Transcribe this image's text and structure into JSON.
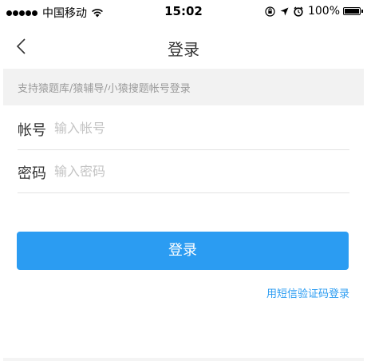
{
  "status_bar": {
    "carrier": "中国移动",
    "time": "15:02",
    "battery": "100%",
    "icons": [
      "signal-dots-icon",
      "wifi-icon",
      "orientation-lock-icon",
      "location-arrow-icon",
      "alarm-icon",
      "battery-icon"
    ]
  },
  "nav": {
    "back_icon": "chevron-left-icon",
    "title": "登录"
  },
  "hint": "支持猿题库/猿辅导/小猿搜题帐号登录",
  "form": {
    "account": {
      "label": "帐号",
      "placeholder": "输入帐号",
      "value": ""
    },
    "password": {
      "label": "密码",
      "placeholder": "输入密码",
      "value": ""
    }
  },
  "login_button": "登录",
  "sms_login_link": "用短信验证码登录",
  "colors": {
    "accent": "#2b9cf2",
    "hint_background": "#f2f2f2",
    "hint_text": "#9b9b9b",
    "placeholder": "#c4c4c4"
  }
}
